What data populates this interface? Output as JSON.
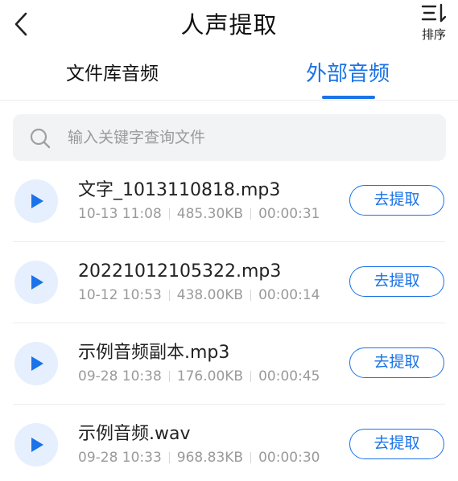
{
  "header": {
    "title": "人声提取",
    "back_icon": "chevron-left-icon",
    "sort": {
      "label": "排序",
      "icon": "sort-icon"
    }
  },
  "tabs": {
    "items": [
      {
        "label": "文件库音频",
        "active": false
      },
      {
        "label": "外部音频",
        "active": true
      }
    ]
  },
  "search": {
    "placeholder": "输入关键字查询文件",
    "value": "",
    "icon": "search-icon"
  },
  "files": [
    {
      "name": "文字_1013110818.mp3",
      "datetime": "10-13 11:08",
      "size": "485.30KB",
      "duration": "00:00:31",
      "action": "去提取"
    },
    {
      "name": "20221012105322.mp3",
      "datetime": "10-12 10:53",
      "size": "438.00KB",
      "duration": "00:00:14",
      "action": "去提取"
    },
    {
      "name": "示例音频副本.mp3",
      "datetime": "09-28 10:38",
      "size": "176.00KB",
      "duration": "00:00:45",
      "action": "去提取"
    },
    {
      "name": "示例音频.wav",
      "datetime": "09-28 10:33",
      "size": "968.83KB",
      "duration": "00:00:30",
      "action": "去提取"
    }
  ],
  "colors": {
    "accent": "#1a73e8",
    "play_bg": "#e6effd",
    "search_bg": "#f2f3f5",
    "meta_text": "#9a9a9a"
  }
}
